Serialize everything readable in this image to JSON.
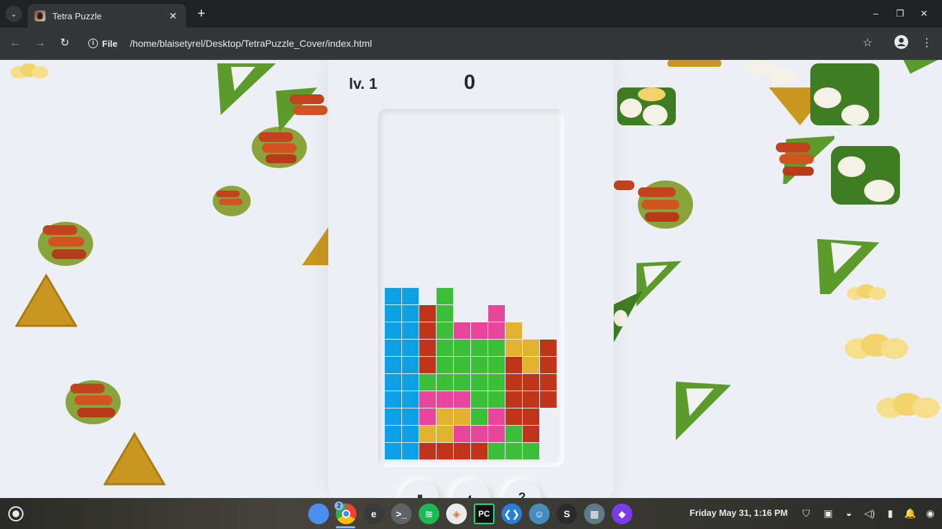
{
  "browser": {
    "tab_title": "Tetra Puzzle",
    "close_tab_glyph": "✕",
    "new_tab_glyph": "+",
    "page_info_scheme": "File",
    "url": "/home/blaisetyrel/Desktop/TetraPuzzle_Cover/index.html",
    "back_glyph": "←",
    "forward_glyph": "→",
    "reload_glyph": "↻",
    "bookmark_glyph": "☆",
    "menu_glyph": "⋮",
    "tab_search_glyph": "⌄",
    "minimize_glyph": "–",
    "restore_glyph": "❐",
    "close_window_glyph": "✕"
  },
  "game": {
    "level_label": "lv. 1",
    "score": "0",
    "colors": {
      "B": "#0ea0e6",
      "R": "#c0341a",
      "G": "#3cbf38",
      "P": "#e8469b",
      "Y": "#e3b22f"
    },
    "board_rows": [
      "..........",
      "..........",
      "..........",
      "..........",
      "..........",
      "..........",
      "..........",
      "..........",
      "..........",
      "..........",
      "BB.G......",
      "BBRG..P...",
      "BBRGPPPY..",
      "BBRGGGGYYR",
      "BBRGGGGRYR",
      "BBGGGGGRRR",
      "BBPPPGGRRR",
      "BBPYYGPRR.",
      "BBYYPPPGR.",
      "BBRRRRGGG."
    ],
    "controls": [
      "⏸",
      "◐",
      "?"
    ]
  },
  "shelf": {
    "chrome_badge": "2",
    "apps": [
      {
        "name": "files-app-icon",
        "label": "",
        "color": "#4a8ef0"
      },
      {
        "name": "chrome-app-icon",
        "label": "",
        "color": "#ea4335"
      },
      {
        "name": "text-editor-app-icon",
        "label": "e",
        "color": "#3a3a3a"
      },
      {
        "name": "terminal-app-icon",
        "label": ">_",
        "color": "#5f6368"
      },
      {
        "name": "spotify-app-icon",
        "label": "≋",
        "color": "#1db954"
      },
      {
        "name": "layers-app-icon",
        "label": "◈",
        "color": "#e8eaed"
      },
      {
        "name": "pycharm-app-icon",
        "label": "PC",
        "color": "#111111"
      },
      {
        "name": "vscode-app-icon",
        "label": "❮❯",
        "color": "#2a7fd4"
      },
      {
        "name": "godot-app-icon",
        "label": "☺",
        "color": "#478cbf"
      },
      {
        "name": "steam-app-icon",
        "label": "S",
        "color": "#2b2b2b"
      },
      {
        "name": "video-app-icon",
        "label": "▦",
        "color": "#5d7c8a"
      },
      {
        "name": "obsidian-app-icon",
        "label": "◆",
        "color": "#7c3aed"
      }
    ],
    "clock": "Friday May 31, 1:16 PM",
    "tray": [
      "⛉",
      "▣",
      "◒",
      "◁)",
      "▮",
      "🔔",
      "◉"
    ]
  }
}
